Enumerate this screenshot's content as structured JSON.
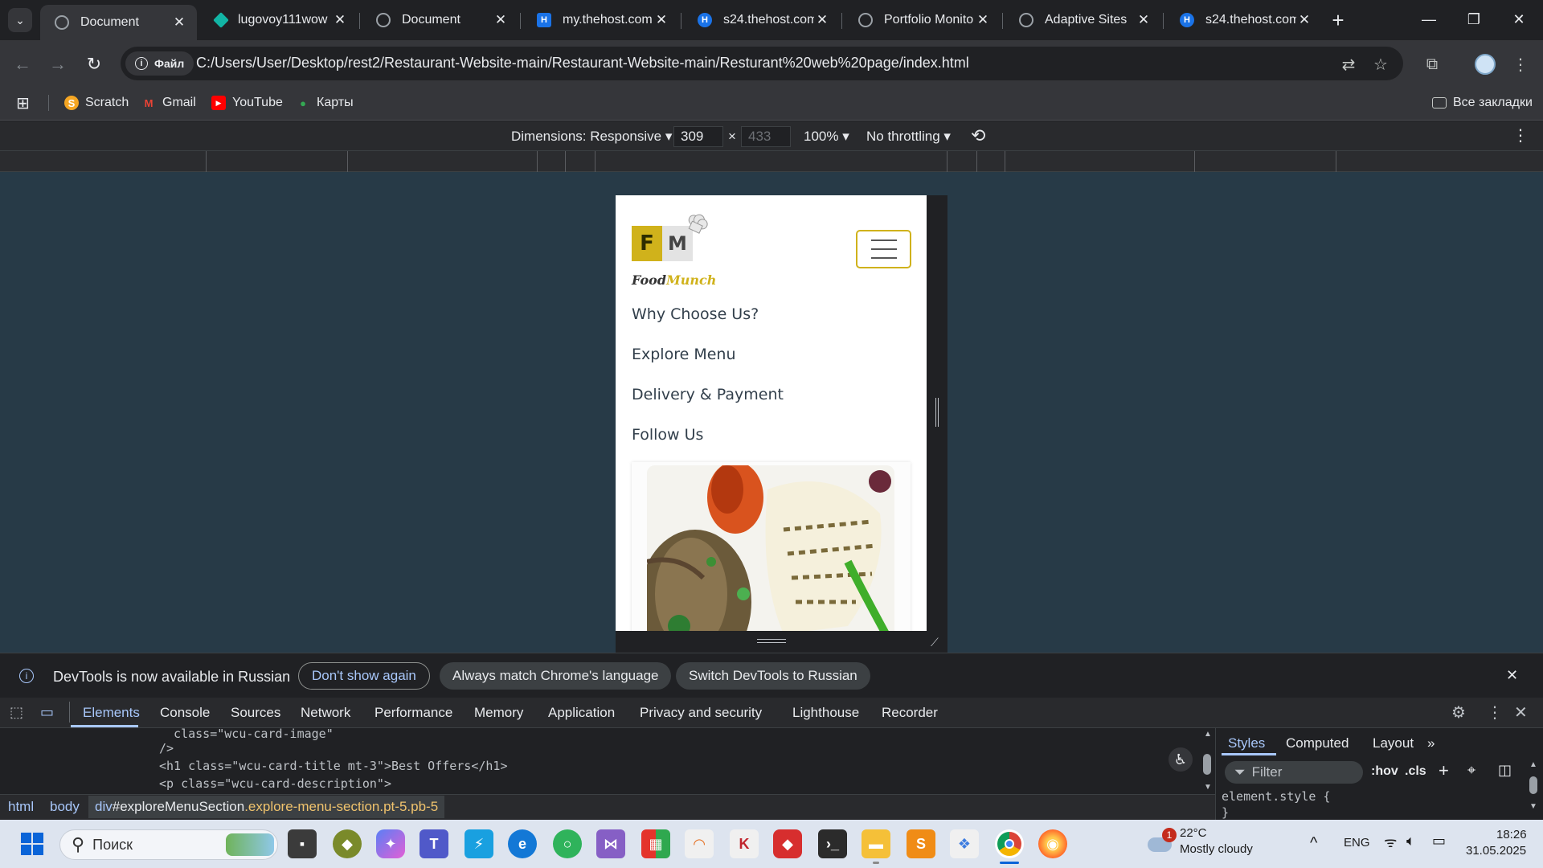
{
  "tabs": [
    {
      "title": "Document",
      "active": true
    },
    {
      "title": "lugovoy111wow",
      "active": false
    },
    {
      "title": "Document",
      "active": false
    },
    {
      "title": "my.thehost.com.",
      "active": false
    },
    {
      "title": "s24.thehost.com.",
      "active": false
    },
    {
      "title": "Portfolio Monito",
      "active": false
    },
    {
      "title": "Adaptive Sites",
      "active": false
    },
    {
      "title": "s24.thehost.com.",
      "active": false
    }
  ],
  "omnibox": {
    "chip_label": "Файл",
    "url": "C:/Users/User/Desktop/rest2/Restaurant-Website-main/Restaurant-Website-main/Resturant%20web%20page/index.html"
  },
  "bookmarks": {
    "items": [
      "Scratch",
      "Gmail",
      "YouTube",
      "Карты"
    ],
    "all_label": "Все закладки"
  },
  "device_toolbar": {
    "dimensions_label": "Dimensions: Responsive",
    "width": "309",
    "height": "433",
    "times": "×",
    "zoom": "100%",
    "throttling": "No throttling"
  },
  "site": {
    "logo_left": "F",
    "logo_right": "M",
    "brand_food": "Food",
    "brand_munch": "Munch",
    "nav_links": [
      "Why Choose Us?",
      "Explore Menu",
      "Delivery & Payment",
      "Follow Us"
    ],
    "accent": "#d0b21b"
  },
  "notice": {
    "text": "DevTools is now available in Russian",
    "dont_show": "Don't show again",
    "always_match": "Always match Chrome's language",
    "switch": "Switch DevTools to Russian"
  },
  "devtools": {
    "tabs": [
      "Elements",
      "Console",
      "Sources",
      "Network",
      "Performance",
      "Memory",
      "Application",
      "Privacy and security",
      "Lighthouse",
      "Recorder"
    ],
    "code_lines": [
      "  class=\"wcu-card-image\"",
      "/>",
      "<h1 class=\"wcu-card-title mt-3\">Best Offers</h1>",
      "<p class=\"wcu-card-description\">"
    ],
    "breadcrumbs": [
      "html",
      "body"
    ],
    "active_crumb_tag": "div",
    "active_crumb_id": "#exploreMenuSection",
    "active_crumb_class": ".explore-menu-section.pt-5.pb-5",
    "style_tabs": [
      "Styles",
      "Computed",
      "Layout"
    ],
    "filter_placeholder": "Filter",
    "hov": ":hov",
    "cls": ".cls",
    "element_style": "element.style {",
    "element_style_close": "}"
  },
  "taskbar": {
    "search_placeholder": "Поиск",
    "weather_temp": "22°C",
    "weather_desc": "Mostly cloudy",
    "weather_badge": "1",
    "lang": "ENG",
    "time": "18:26",
    "date": "31.05.2025"
  }
}
